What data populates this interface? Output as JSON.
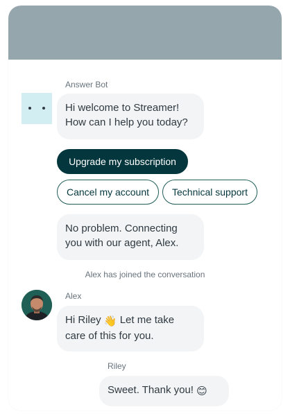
{
  "conversation": {
    "bot": {
      "name": "Answer Bot",
      "greeting_line1": "Hi welcome to Streamer!",
      "greeting_line2": "How can I help you today?"
    },
    "quick_replies": [
      {
        "label": "Upgrade my subscription",
        "style": "primary"
      },
      {
        "label": "Cancel my account",
        "style": "outline"
      },
      {
        "label": "Technical support",
        "style": "outline"
      }
    ],
    "bot_reply": {
      "line1": "No problem. Connecting",
      "line2": "you with our agent, Alex."
    },
    "system_message": "Alex has joined the conversation",
    "agent": {
      "name": "Alex",
      "line1_text": "Hi Riley",
      "line1_emoji": "👋",
      "line1_rest": "Let me take",
      "line2": "care of this for you."
    },
    "user": {
      "name": "Riley",
      "message": "Sweet. Thank you!",
      "emoji": "😊"
    }
  },
  "colors": {
    "header": "#95a6ad",
    "primary": "#03363d",
    "bubble": "#f3f4f5",
    "bot_avatar": "#d2eef2"
  }
}
